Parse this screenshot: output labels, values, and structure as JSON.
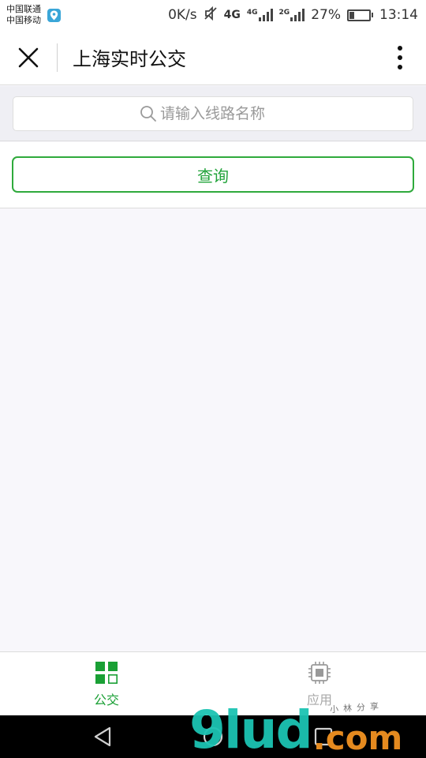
{
  "status_bar": {
    "carrier_1": "中国联通",
    "carrier_2": "中国移动",
    "net_speed": "0K/s",
    "network_4g": "4G",
    "sig1_tag": "4G",
    "sig2_tag": "2G",
    "battery_percent": "27%",
    "battery_level": 0.27,
    "time": "13:14"
  },
  "header": {
    "title": "上海实时公交",
    "close_icon": "close-icon",
    "more_icon": "more-vertical-icon"
  },
  "search": {
    "placeholder": "请输入线路名称",
    "value": ""
  },
  "query": {
    "button_label": "查询"
  },
  "tabs": [
    {
      "label": "公交",
      "icon": "grid-icon",
      "active": true
    },
    {
      "label": "应用",
      "icon": "chip-icon",
      "active": false
    }
  ],
  "watermark": {
    "main": "9lud",
    "dot": ".com",
    "small": "小林分享"
  },
  "colors": {
    "accent_green": "#21a33a",
    "watermark_teal": "#1cc3b3",
    "watermark_orange": "#e58a1f"
  }
}
